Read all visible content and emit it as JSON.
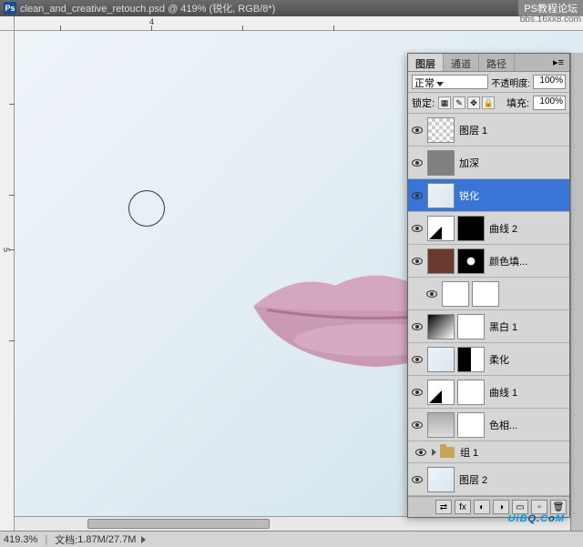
{
  "watermark": {
    "line1": "PS教程论坛",
    "line2": "bbs.16xx8.com"
  },
  "titlebar": {
    "icon_text": "Ps",
    "filename": "clean_and_creative_retouch.psd",
    "zoom_in_title": "419%",
    "mode": "(锐化, RGB/8*)"
  },
  "statusbar": {
    "zoom": "419.3%",
    "doc_label": "文档:",
    "doc_size": "1.87M/27.7M"
  },
  "panel": {
    "tabs": [
      "图层",
      "通道",
      "路径"
    ],
    "active_tab": 0,
    "blend_mode": "正常",
    "opacity_label": "不透明度:",
    "opacity_value": "100%",
    "lock_label": "锁定:",
    "fill_label": "填充:",
    "fill_value": "100%",
    "layers": [
      {
        "name": "图层 1",
        "visible": true,
        "thumb": "checker"
      },
      {
        "name": "加深",
        "visible": true,
        "thumb": "gray"
      },
      {
        "name": "锐化",
        "visible": true,
        "thumb": "face",
        "selected": true
      },
      {
        "name": "曲线 2",
        "visible": true,
        "thumb": "adj-curves",
        "mask": "black"
      },
      {
        "name": "颜色填...",
        "visible": true,
        "thumb": "brown",
        "mask": "spot"
      },
      {
        "name": "",
        "visible": true,
        "thumb": "adj-hist",
        "mask": "white",
        "indent": true
      },
      {
        "name": "黑白 1",
        "visible": true,
        "thumb": "gradient",
        "mask": "white"
      },
      {
        "name": "柔化",
        "visible": true,
        "thumb": "face",
        "mask": "half"
      },
      {
        "name": "曲线 1",
        "visible": true,
        "thumb": "adj-curves",
        "mask": "white"
      },
      {
        "name": "色相...",
        "visible": true,
        "thumb": "gray-grad",
        "mask": "white"
      },
      {
        "name": "组 1",
        "visible": true,
        "type": "group"
      },
      {
        "name": "图层 2",
        "visible": true,
        "thumb": "face"
      }
    ]
  },
  "logo": {
    "text1": "UiB",
    "text2": "Q.",
    "text3": "C",
    "text4": "o",
    "text5": "M"
  },
  "ruler": {
    "h_marks": [
      "4"
    ],
    "v_marks": [
      "5"
    ]
  }
}
